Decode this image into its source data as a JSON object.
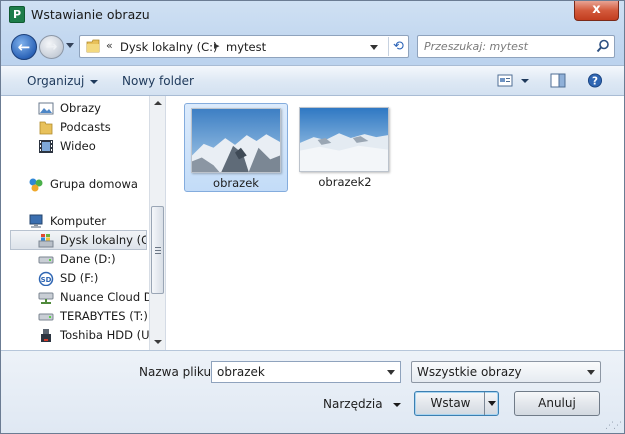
{
  "window": {
    "title": "Wstawianie obrazu",
    "app_icon_letter": "P",
    "close_glyph": "x"
  },
  "nav": {
    "back_glyph": "←",
    "forward_glyph": "→"
  },
  "address": {
    "sep1": "«",
    "crumb1": "Dysk lokalny (C:)",
    "sep2": "▸",
    "crumb2": "mytest",
    "refresh_glyph": "⟲"
  },
  "search": {
    "placeholder": "Przeszukaj: mytest"
  },
  "toolbar": {
    "organize": "Organizuj",
    "new_folder": "Nowy folder"
  },
  "sidebar": {
    "items": [
      {
        "label": "Obrazy",
        "icon": "pictures-icon"
      },
      {
        "label": "Podcasts",
        "icon": "folder-icon"
      },
      {
        "label": "Wideo",
        "icon": "video-icon"
      },
      {
        "label": "Grupa domowa",
        "icon": "homegroup-icon"
      },
      {
        "label": "Komputer",
        "icon": "computer-icon"
      },
      {
        "label": "Dysk lokalny (C:)",
        "icon": "windows-drive-icon",
        "selected": true
      },
      {
        "label": "Dane (D:)",
        "icon": "drive-icon"
      },
      {
        "label": "SD (F:)",
        "icon": "sd-card-icon"
      },
      {
        "label": "Nuance Cloud Dr",
        "icon": "network-drive-icon"
      },
      {
        "label": "TERABYTES (T:)",
        "icon": "drive-icon"
      },
      {
        "label": "Toshiba HDD (U:)",
        "icon": "usb-drive-icon"
      }
    ]
  },
  "files": [
    {
      "name": "obrazek",
      "selected": true
    },
    {
      "name": "obrazek2",
      "selected": false
    }
  ],
  "footer": {
    "filename_label": "Nazwa pliku:",
    "filename_value": "obrazek",
    "filter_value": "Wszystkie obrazy",
    "tools_label": "Narzędzia",
    "insert_label": "Wstaw",
    "cancel_label": "Anuluj"
  },
  "colors": {
    "selection": "#c3dcf8",
    "close": "#c23d1f",
    "accent": "#2c64b8"
  }
}
